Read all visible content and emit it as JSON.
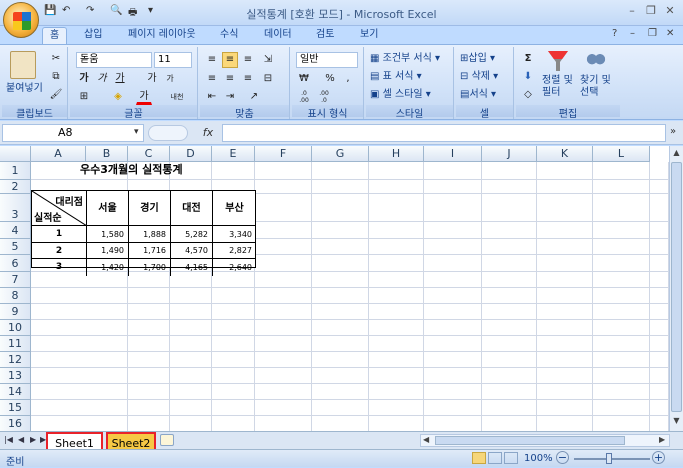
{
  "window": {
    "title": "실적통계 [호환 모드] - Microsoft Excel",
    "minimize": "–",
    "restore": "❐",
    "close": "✕",
    "wb_min": "–",
    "wb_restore": "❐",
    "wb_close": "✕"
  },
  "qat": {
    "save": "💾",
    "undo": "↶",
    "redo": "↷",
    "preview": "🔍",
    "print": "🖶",
    "more": "▾"
  },
  "tabs": [
    "홈",
    "삽입",
    "페이지 레이아웃",
    "수식",
    "데이터",
    "검토",
    "보기"
  ],
  "help": "?",
  "ribbon": {
    "clipboard": {
      "label": "클립보드",
      "paste": "붙여넣기",
      "cut": "✂",
      "copy": "⧉",
      "format_painter": "🖌"
    },
    "font": {
      "label": "글꼴",
      "font_name": "돋움",
      "font_size": "11",
      "bold": "가",
      "italic": "가",
      "underline": "가",
      "grow": "가",
      "shrink": "가",
      "border": "⊞",
      "fill": "◈",
      "color": "가",
      "phonetic": "내천"
    },
    "alignment": {
      "label": "맞춤"
    },
    "number": {
      "label": "표시 형식",
      "format": "일반",
      "currency": "₩",
      "percent": "%",
      "comma": ",",
      "inc": ".0\n.00",
      "dec": ".00\n.0"
    },
    "styles": {
      "label": "스타일",
      "conditional": "조건부 서식",
      "table": "표 서식",
      "cell": "셀 스타일"
    },
    "cells": {
      "label": "셀",
      "insert": "삽입",
      "delete": "삭제",
      "format": "서식"
    },
    "editing": {
      "label": "편집",
      "sum": "Σ",
      "fill": "⬇",
      "clear": "◇",
      "sort": "정렬 및\n필터",
      "find": "찾기 및\n선택"
    }
  },
  "formula": {
    "name_box": "A8",
    "fx": "fx",
    "value": ""
  },
  "columns": [
    "A",
    "B",
    "C",
    "D",
    "E",
    "F",
    "G",
    "H",
    "I",
    "J",
    "K",
    "L"
  ],
  "rows": [
    "1",
    "2",
    "3",
    "4",
    "5",
    "6",
    "7",
    "8",
    "9",
    "10",
    "11",
    "12",
    "13",
    "14",
    "15",
    "16",
    "17"
  ],
  "sheet": {
    "title": "우수3개월의 실적통계",
    "corner_top": "대리점",
    "corner_bottom": "실적순",
    "headers": [
      "서울",
      "경기",
      "대전",
      "부산"
    ],
    "data": [
      {
        "rank": "1",
        "values": [
          "1,580",
          "1,888",
          "5,282",
          "3,340"
        ]
      },
      {
        "rank": "2",
        "values": [
          "1,490",
          "1,716",
          "4,570",
          "2,827"
        ]
      },
      {
        "rank": "3",
        "values": [
          "1,420",
          "1,700",
          "4,165",
          "2,640"
        ]
      }
    ]
  },
  "sheet_tabs": [
    "Sheet1",
    "Sheet2"
  ],
  "status": {
    "ready": "준비",
    "zoom": "100%"
  },
  "colors": {
    "highlight_border": "#e8222a",
    "sheet2_fill": "#f6c845"
  }
}
